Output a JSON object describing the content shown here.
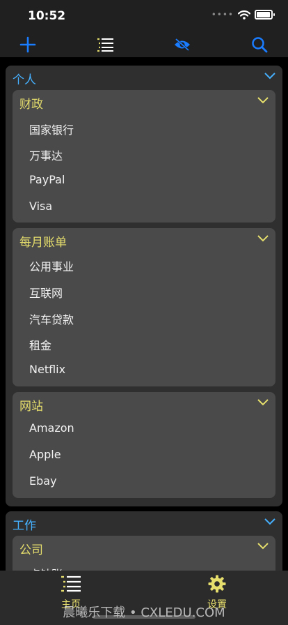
{
  "status": {
    "time": "10:52"
  },
  "colors": {
    "accent": "#1a7cff",
    "group_title": "#46b1ff",
    "sub_title": "#e6de6c"
  },
  "toolbar": {
    "add_icon": "plus-icon",
    "list_icon": "list-icon",
    "visibility_icon": "eye-slash-icon",
    "search_icon": "search-icon"
  },
  "groups": [
    {
      "title": "个人",
      "subgroups": [
        {
          "title": "财政",
          "items": [
            "国家银行",
            "万事达",
            "PayPal",
            "Visa"
          ]
        },
        {
          "title": "每月账单",
          "items": [
            "公用事业",
            "互联网",
            "汽车贷款",
            "租金",
            "Netflix"
          ]
        },
        {
          "title": "网站",
          "items": [
            "Amazon",
            "Apple",
            "Ebay"
          ]
        }
      ]
    },
    {
      "title": "工作",
      "subgroups": [
        {
          "title": "公司",
          "items": [
            "点钞账"
          ]
        }
      ]
    }
  ],
  "tabbar": {
    "home_label": "主页",
    "settings_label": "设置"
  },
  "watermark": "晨曦乐下载 • CXLEDU.COM"
}
